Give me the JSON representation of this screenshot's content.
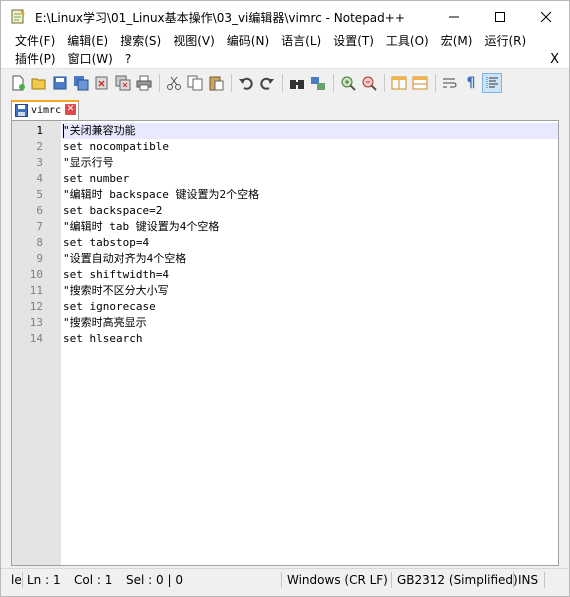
{
  "window": {
    "title": "E:\\Linux学习\\01_Linux基本操作\\03_vi编辑器\\vimrc - Notepad++",
    "minimize": "—",
    "maximize": "☐",
    "close": "✕"
  },
  "menu": {
    "row1": [
      "文件(F)",
      "编辑(E)",
      "搜索(S)",
      "视图(V)",
      "编码(N)",
      "语言(L)",
      "设置(T)",
      "工具(O)",
      "宏(M)",
      "运行(R)"
    ],
    "row2": [
      "插件(P)",
      "窗口(W)",
      "?"
    ],
    "close_doc": "X"
  },
  "tab": {
    "label": "vimrc",
    "close": "✕"
  },
  "editor": {
    "lines": [
      {
        "n": "1",
        "text": "\"关闭兼容功能"
      },
      {
        "n": "2",
        "text": "set nocompatible"
      },
      {
        "n": "3",
        "text": "\"显示行号"
      },
      {
        "n": "4",
        "text": "set number"
      },
      {
        "n": "5",
        "text": "\"编辑时 backspace 键设置为2个空格"
      },
      {
        "n": "6",
        "text": "set backspace=2"
      },
      {
        "n": "7",
        "text": "\"编辑时 tab 键设置为4个空格"
      },
      {
        "n": "8",
        "text": "set tabstop=4"
      },
      {
        "n": "9",
        "text": "\"设置自动对齐为4个空格"
      },
      {
        "n": "10",
        "text": "set shiftwidth=4"
      },
      {
        "n": "11",
        "text": "\"搜索时不区分大小写"
      },
      {
        "n": "12",
        "text": "set ignorecase"
      },
      {
        "n": "13",
        "text": "\"搜索时高亮显示"
      },
      {
        "n": "14",
        "text": "set hlsearch"
      }
    ]
  },
  "status": {
    "type": "le",
    "ln": "Ln : 1",
    "col": "Col : 1",
    "sel": "Sel : 0 | 0",
    "eol": "Windows (CR LF)",
    "encoding": "GB2312 (Simplified)",
    "mode": "INS"
  },
  "colors": {
    "current_line": "#e8e8ff",
    "gutter": "#e4e4e4",
    "tab_accent": "#f6a623",
    "tab_close": "#e24b4b"
  },
  "icons": [
    "new-file-icon",
    "open-file-icon",
    "save-icon",
    "save-all-icon",
    "close-icon",
    "close-all-icon",
    "print-icon",
    "cut-icon",
    "copy-icon",
    "paste-icon",
    "undo-icon",
    "redo-icon",
    "find-icon",
    "replace-icon",
    "zoom-in-icon",
    "zoom-out-icon",
    "sync-vertical-icon",
    "sync-horizontal-icon",
    "word-wrap-icon",
    "show-all-chars-icon",
    "indent-guide-icon"
  ]
}
